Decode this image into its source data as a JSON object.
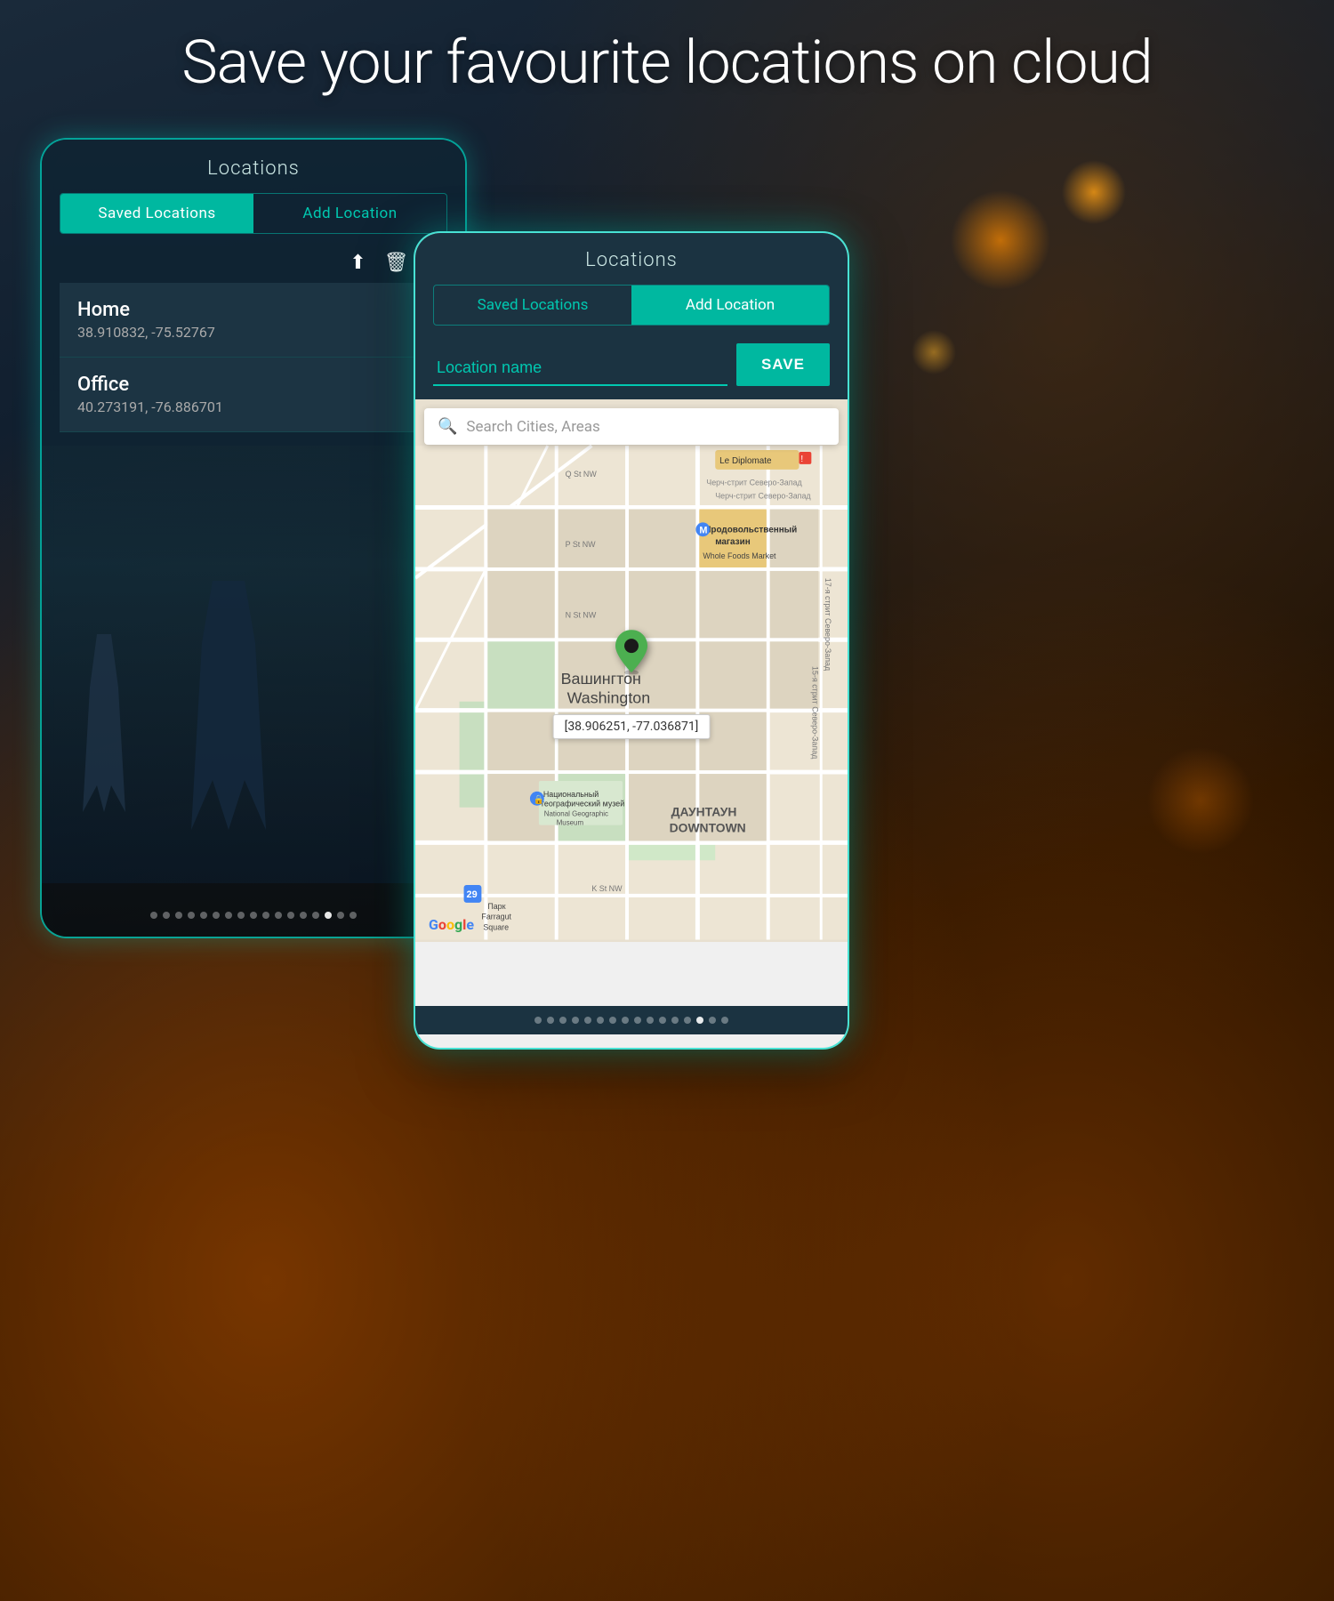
{
  "headline": "Save your favourite locations on cloud",
  "phone1": {
    "title": "Locations",
    "tabs": [
      {
        "label": "Saved Locations",
        "active": true
      },
      {
        "label": "Add Location",
        "active": false
      }
    ],
    "toolbar": {
      "upload_icon": "⬆",
      "delete_icon": "🗑",
      "share_icon": "↗"
    },
    "locations": [
      {
        "name": "Home",
        "coords": "38.910832, -75.52767"
      },
      {
        "name": "Office",
        "coords": "40.273191, -76.886701"
      }
    ],
    "dots": [
      false,
      false,
      false,
      false,
      false,
      false,
      false,
      false,
      false,
      false,
      false,
      false,
      false,
      false,
      true,
      false,
      false
    ]
  },
  "phone2": {
    "title": "Locations",
    "tabs": [
      {
        "label": "Saved Locations",
        "active": false
      },
      {
        "label": "Add Location",
        "active": true
      }
    ],
    "input_placeholder": "Location name",
    "save_button": "SAVE",
    "map_search_placeholder": "Search Cities, Areas",
    "map_pin_coords": "[38.906251, -77.036871]",
    "city_label_ru": "Вашингтон",
    "city_label_en": "Washington",
    "google_logo": "Google",
    "dots": [
      false,
      false,
      false,
      false,
      false,
      false,
      false,
      false,
      false,
      false,
      false,
      false,
      false,
      true,
      false,
      false
    ]
  }
}
